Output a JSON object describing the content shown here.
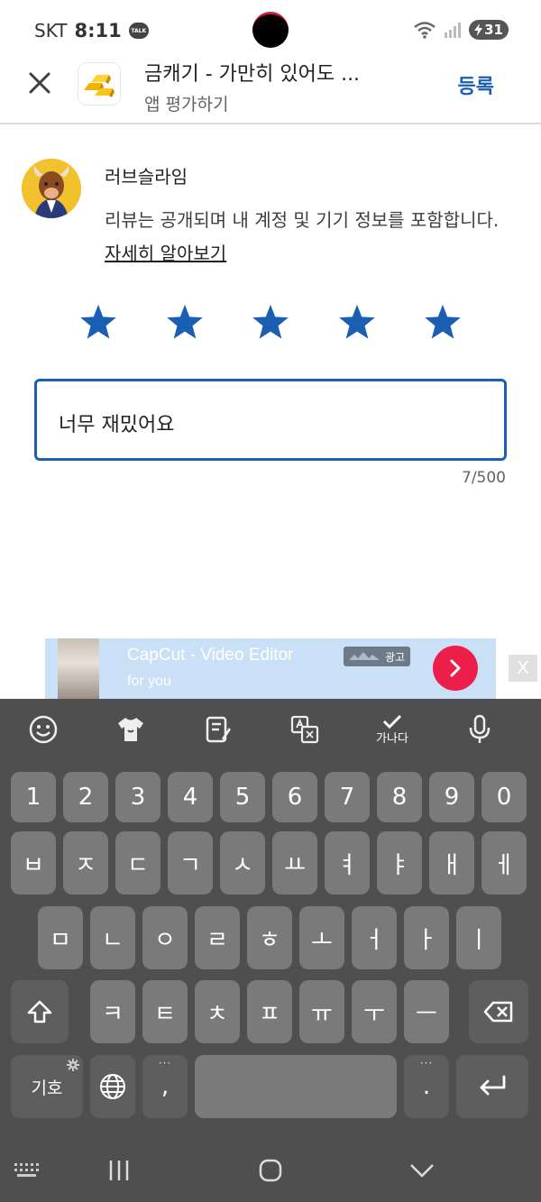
{
  "status_bar": {
    "carrier": "SKT",
    "time": "8:11",
    "talk_badge": "TALK",
    "battery": "31"
  },
  "app_bar": {
    "title": "금캐기 - 가만히 있어도 ...",
    "subtitle": "앱 평가하기",
    "submit_label": "등록"
  },
  "review": {
    "user_name": "러브슬라임",
    "notice_text": "리뷰는 공개되며 내 계정 및 기기 정보를 포함합니다.",
    "notice_link": "자세히 알아보기",
    "rating": 5,
    "rating_max": 5,
    "text": "너무 재밌어요",
    "char_count": "7/500"
  },
  "ad": {
    "title": "CapCut - Video Editor",
    "subtitle": "for you",
    "badge": "광고",
    "close": "X"
  },
  "keyboard": {
    "toolbar": {
      "input_mode_label": "가나다"
    },
    "row_numbers": [
      "1",
      "2",
      "3",
      "4",
      "5",
      "6",
      "7",
      "8",
      "9",
      "0"
    ],
    "row_1": [
      "ㅂ",
      "ㅈ",
      "ㄷ",
      "ㄱ",
      "ㅅ",
      "ㅛ",
      "ㅕ",
      "ㅑ",
      "ㅐ",
      "ㅔ"
    ],
    "row_2": [
      "ㅁ",
      "ㄴ",
      "ㅇ",
      "ㄹ",
      "ㅎ",
      "ㅗ",
      "ㅓ",
      "ㅏ",
      "ㅣ"
    ],
    "row_3": [
      "ㅋ",
      "ㅌ",
      "ㅊ",
      "ㅍ",
      "ㅠ",
      "ㅜ",
      "ㅡ"
    ],
    "bottom": {
      "symbols": "기호",
      "comma": ",",
      "period": "."
    }
  },
  "colors": {
    "accent": "#1a5fb4",
    "star": "#1a5fb4",
    "ad_background": "#c9e0f7",
    "ad_button": "#ec1f4b",
    "keyboard_bg": "#4f4f4f",
    "key_bg": "#7a7a7a"
  }
}
